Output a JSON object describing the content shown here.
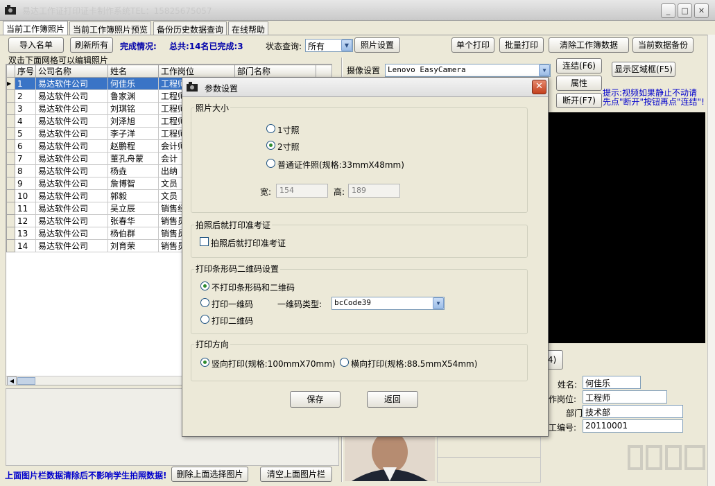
{
  "app": {
    "title": "易达工作证打印证卡制作系统TEL：15825675057"
  },
  "tabs": [
    "当前工作簿照片",
    "当前工作簿照片预览",
    "备份历史数据查询",
    "在线帮助"
  ],
  "toolbar": {
    "import": "导入名单",
    "refresh": "刷新所有",
    "status_label": "完成情况:",
    "status_value": "总共:14名已完成:3",
    "query_label": "状态查询:",
    "query_value": "所有",
    "photo_settings": "照片设置",
    "print_single": "单个打印",
    "print_batch": "批量打印",
    "clear_data": "清除工作簿数据",
    "backup": "当前数据备份"
  },
  "grid": {
    "hint": "双击下面网格可以编辑照片",
    "columns": [
      "序号",
      "公司名称",
      "姓名",
      "工作岗位",
      "部门名称"
    ],
    "rows": [
      {
        "no": "1",
        "company": "易达软件公司",
        "name": "何佳乐",
        "post": "工程师"
      },
      {
        "no": "2",
        "company": "易达软件公司",
        "name": "鲁家渊",
        "post": "工程师"
      },
      {
        "no": "3",
        "company": "易达软件公司",
        "name": "刘琪铭",
        "post": "工程师"
      },
      {
        "no": "4",
        "company": "易达软件公司",
        "name": "刘泽旭",
        "post": "工程师"
      },
      {
        "no": "5",
        "company": "易达软件公司",
        "name": "李子洋",
        "post": "工程师"
      },
      {
        "no": "6",
        "company": "易达软件公司",
        "name": "赵鹏程",
        "post": "会计师"
      },
      {
        "no": "7",
        "company": "易达软件公司",
        "name": "董孔舟蒙",
        "post": "会计"
      },
      {
        "no": "8",
        "company": "易达软件公司",
        "name": "杨垚",
        "post": "出纳"
      },
      {
        "no": "9",
        "company": "易达软件公司",
        "name": "詹博智",
        "post": "文员"
      },
      {
        "no": "10",
        "company": "易达软件公司",
        "name": "郭毅",
        "post": "文员"
      },
      {
        "no": "11",
        "company": "易达软件公司",
        "name": "吴立辰",
        "post": "销售经理"
      },
      {
        "no": "12",
        "company": "易达软件公司",
        "name": "张春华",
        "post": "销售员"
      },
      {
        "no": "13",
        "company": "易达软件公司",
        "name": "杨伯群",
        "post": "销售员"
      },
      {
        "no": "14",
        "company": "易达软件公司",
        "name": "刘育荣",
        "post": "销售员"
      }
    ]
  },
  "camera": {
    "label": "摄像设置",
    "device": "Lenovo EasyCamera",
    "connect": "连结(F6)",
    "properties": "属性",
    "disconnect": "断开(F7)",
    "show_area": "显示区域框(F5)",
    "tip1": "提示:视频如果静止不动请",
    "tip2": "先点\"断开\"按钮再点\"连结\"!",
    "capture_suffix": "4)"
  },
  "person": {
    "name_label": "姓名:",
    "name": "何佳乐",
    "post_label": "作岗位:",
    "post": "工程师",
    "dept_label": "部门:",
    "dept": "技术部",
    "id_label": "工编号:",
    "id": "20110001"
  },
  "bottom": {
    "note": "上面图片栏数据清除后不影响学生拍照数据!",
    "delete_selected": "删除上面选择图片",
    "clear_all": "清空上面图片栏"
  },
  "dialog": {
    "title": "参数设置",
    "photo_size": {
      "legend": "照片大小",
      "opt1": "1寸照",
      "opt2": "2寸照",
      "opt3": "普通证件照(规格:33mmX48mm)",
      "selected": 2,
      "w_label": "宽:",
      "w_value": "154",
      "h_label": "高:",
      "h_value": "189"
    },
    "print_after": {
      "legend": "拍照后就打印准考证",
      "check_label": "拍照后就打印准考证",
      "checked": false
    },
    "barcode": {
      "legend": "打印条形码二维码设置",
      "opt1": "不打印条形码和二维码",
      "opt2": "打印一维码",
      "opt3": "打印二维码",
      "type_label": "一维码类型:",
      "type_value": "bcCode39",
      "selected": 1
    },
    "orientation": {
      "legend": "打印方向",
      "opt1": "竖向打印(规格:100mmX70mm)",
      "opt2": "横向打印(规格:88.5mmX54mm)",
      "selected": 1
    },
    "save": "保存",
    "back": "返回"
  }
}
